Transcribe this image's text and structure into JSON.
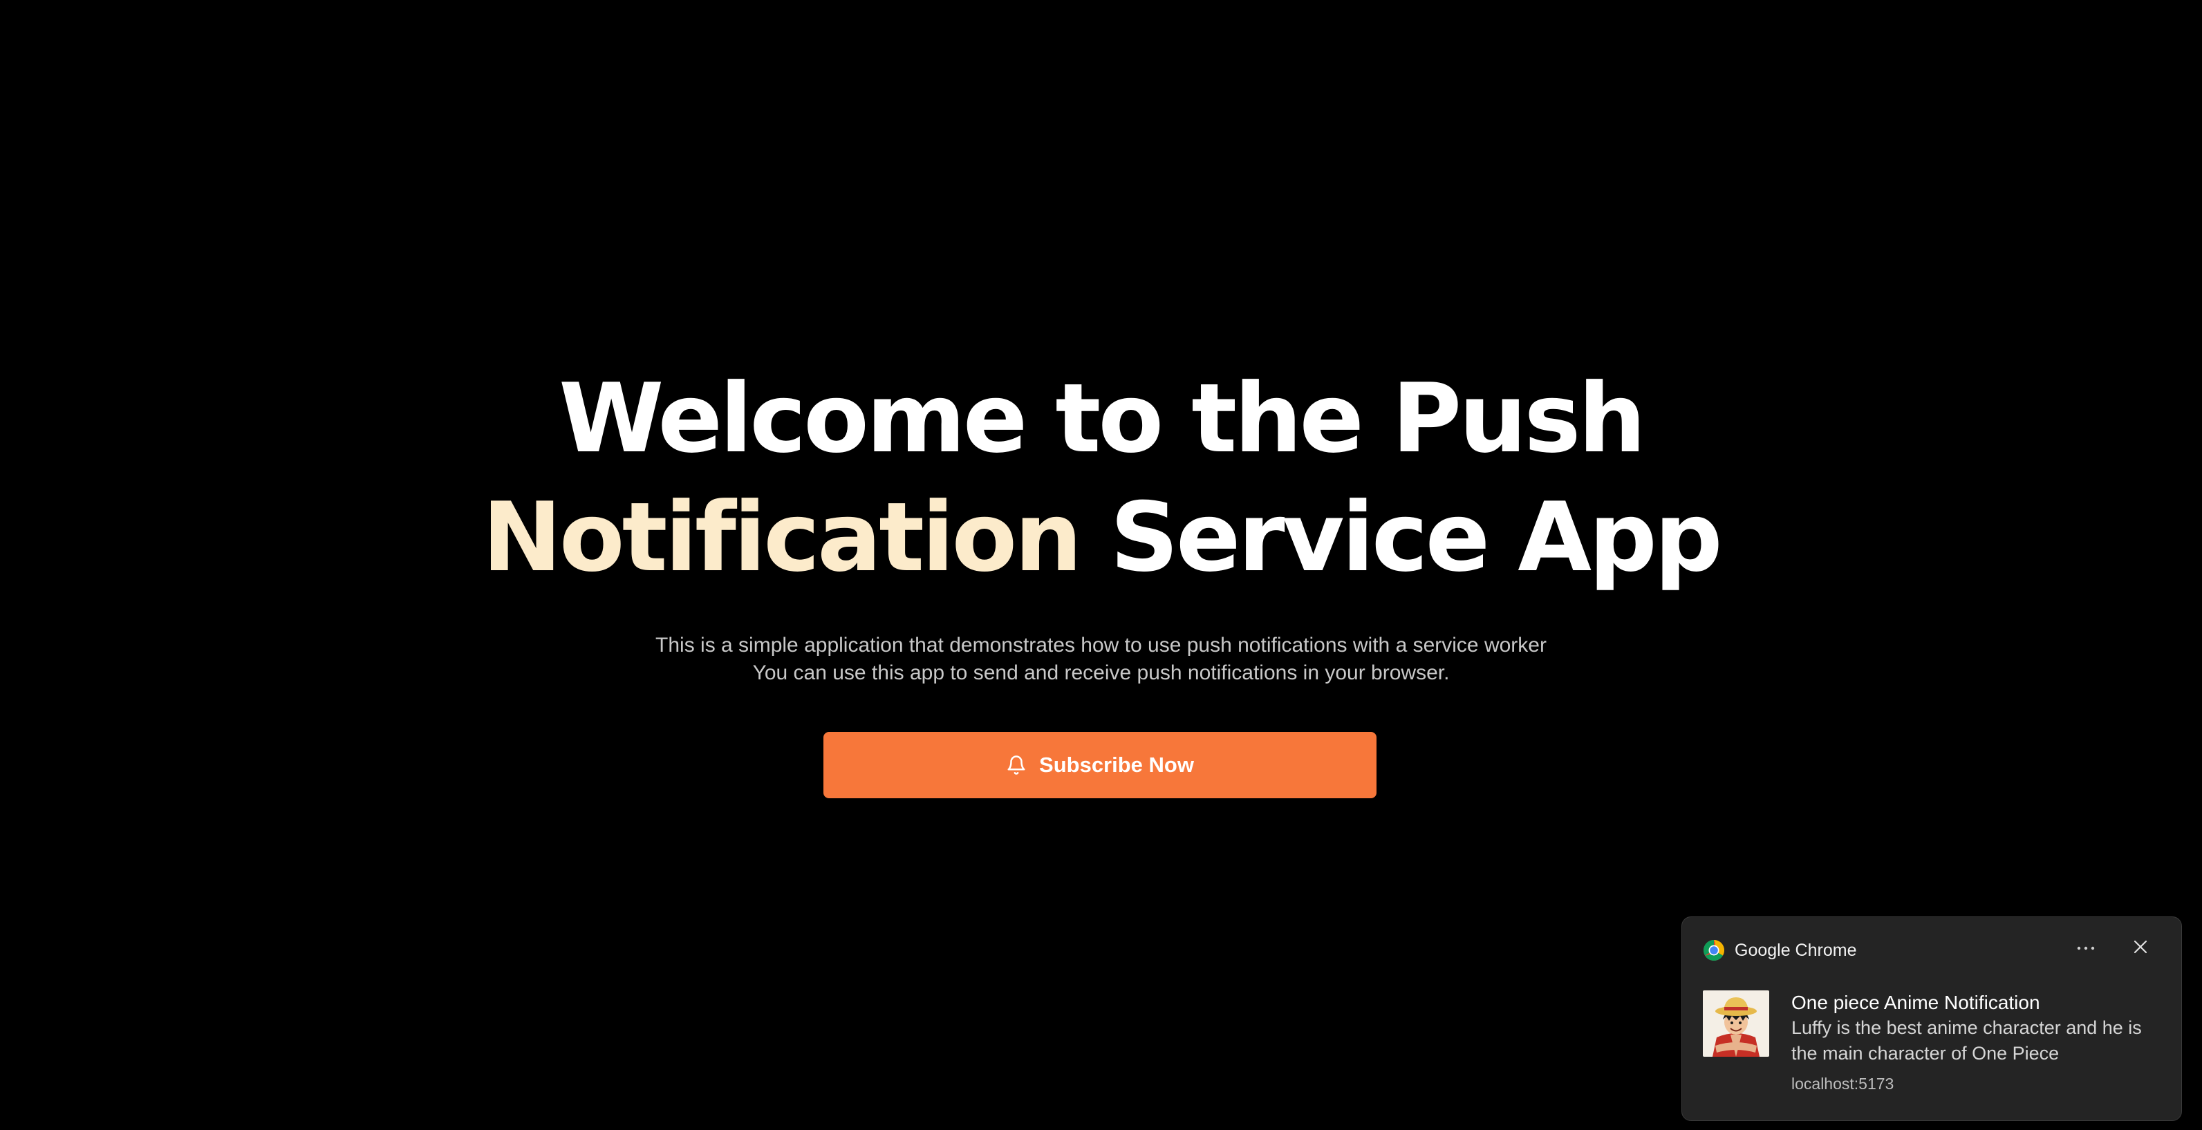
{
  "hero": {
    "title_line1": "Welcome to the Push",
    "title_accent": "Notification",
    "title_line2_rest": " Service App",
    "description_line1": "This is a simple application that demonstrates how to use push notifications with a service worker",
    "description_line2": "You can use this app to send and receive push notifications in your browser."
  },
  "subscribe": {
    "label": "Subscribe Now",
    "icon": "bell-icon"
  },
  "notification": {
    "app_name": "Google Chrome",
    "app_icon": "chrome-icon",
    "title": "One piece Anime Notification",
    "message": "Luffy is the best anime character and he is the main character of One Piece",
    "source": "localhost:5173"
  },
  "colors": {
    "background": "#000000",
    "accent_text": "#fcebcb",
    "button": "#f7773a",
    "toast_background": "#242424"
  }
}
